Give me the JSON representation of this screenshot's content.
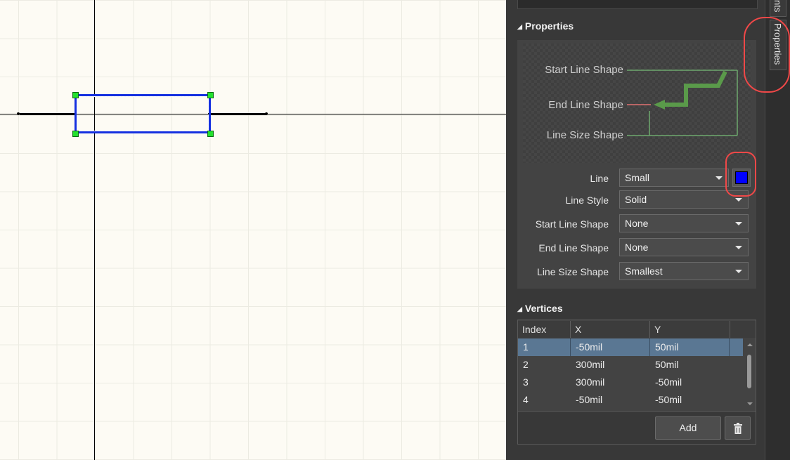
{
  "panel": {
    "properties_header": "Properties",
    "preview_labels": {
      "start_line_shape": "Start Line Shape",
      "end_line_shape": "End Line Shape",
      "line_size_shape": "Line Size Shape"
    },
    "rows": [
      {
        "label": "Line",
        "value": "Small"
      },
      {
        "label": "Line Style",
        "value": "Solid"
      },
      {
        "label": "Start Line Shape",
        "value": "None"
      },
      {
        "label": "End Line Shape",
        "value": "None"
      },
      {
        "label": "Line Size Shape",
        "value": "Smallest"
      }
    ],
    "line_color": "#0000ff",
    "vertices_header": "Vertices",
    "table": {
      "columns": [
        "Index",
        "X",
        "Y"
      ],
      "rows": [
        {
          "index": "1",
          "x": "-50mil",
          "y": "50mil"
        },
        {
          "index": "2",
          "x": "300mil",
          "y": "50mil"
        },
        {
          "index": "3",
          "x": "300mil",
          "y": "-50mil"
        },
        {
          "index": "4",
          "x": "-50mil",
          "y": "-50mil"
        }
      ],
      "selected_row": "1"
    },
    "add_button": "Add",
    "delete_icon": "trash-icon"
  },
  "tabs": {
    "components_partial": "nts",
    "properties": "Properties"
  },
  "colors": {
    "selection_outline": "#1530e0",
    "handle": "#23e12e",
    "annotation": "#f04848",
    "preview_line": "#6fa86f"
  }
}
